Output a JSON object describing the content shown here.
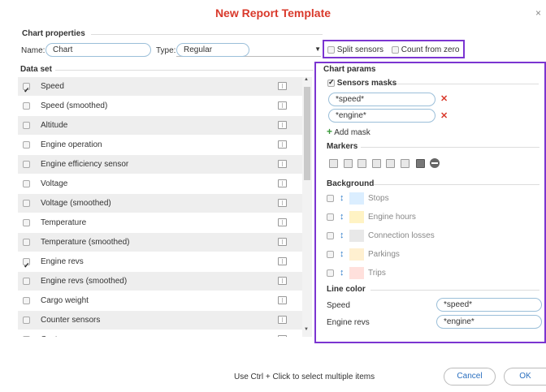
{
  "dialog": {
    "title": "New Report Template",
    "close_glyph": "×"
  },
  "chart_properties": {
    "legend": "Chart properties",
    "name_label": "Name:",
    "name_value": "Chart",
    "type_label": "Type:",
    "type_value": "Regular",
    "split_sensors_label": "Split sensors",
    "split_sensors_checked": false,
    "count_from_zero_label": "Count from zero",
    "count_from_zero_checked": false
  },
  "data_set": {
    "legend": "Data set",
    "items": [
      {
        "label": "Speed",
        "checked": true
      },
      {
        "label": "Speed (smoothed)",
        "checked": false
      },
      {
        "label": "Altitude",
        "checked": false
      },
      {
        "label": "Engine operation",
        "checked": false
      },
      {
        "label": "Engine efficiency sensor",
        "checked": false
      },
      {
        "label": "Voltage",
        "checked": false
      },
      {
        "label": "Voltage (smoothed)",
        "checked": false
      },
      {
        "label": "Temperature",
        "checked": false
      },
      {
        "label": "Temperature (smoothed)",
        "checked": false
      },
      {
        "label": "Engine revs",
        "checked": true
      },
      {
        "label": "Engine revs (smoothed)",
        "checked": false
      },
      {
        "label": "Cargo weight",
        "checked": false
      },
      {
        "label": "Counter sensors",
        "checked": false
      },
      {
        "label": "Custom sensors",
        "checked": false
      }
    ]
  },
  "chart_params": {
    "legend": "Chart params",
    "sensors_masks": {
      "label": "Sensors masks",
      "checked": true,
      "masks": [
        "*speed*",
        "*engine*"
      ],
      "add_label": "Add mask"
    },
    "markers_legend": "Markers",
    "background": {
      "legend": "Background",
      "items": [
        {
          "label": "Stops",
          "color": "#dbeeff"
        },
        {
          "label": "Engine hours",
          "color": "#fff3c4"
        },
        {
          "label": "Connection losses",
          "color": "#e8e8e8"
        },
        {
          "label": "Parkings",
          "color": "#fff0d0"
        },
        {
          "label": "Trips",
          "color": "#ffe0dc"
        }
      ]
    },
    "line_color": {
      "legend": "Line color",
      "rows": [
        {
          "label": "Speed",
          "value": "*speed*"
        },
        {
          "label": "Engine revs",
          "value": "*engine*"
        }
      ]
    }
  },
  "footer": {
    "hint": "Use Ctrl + Click to select multiple items",
    "cancel_label": "Cancel",
    "ok_label": "OK"
  },
  "colors": {
    "accent": "#d9392b",
    "highlight_border": "#7b35d1",
    "link": "#2a6fbf"
  }
}
